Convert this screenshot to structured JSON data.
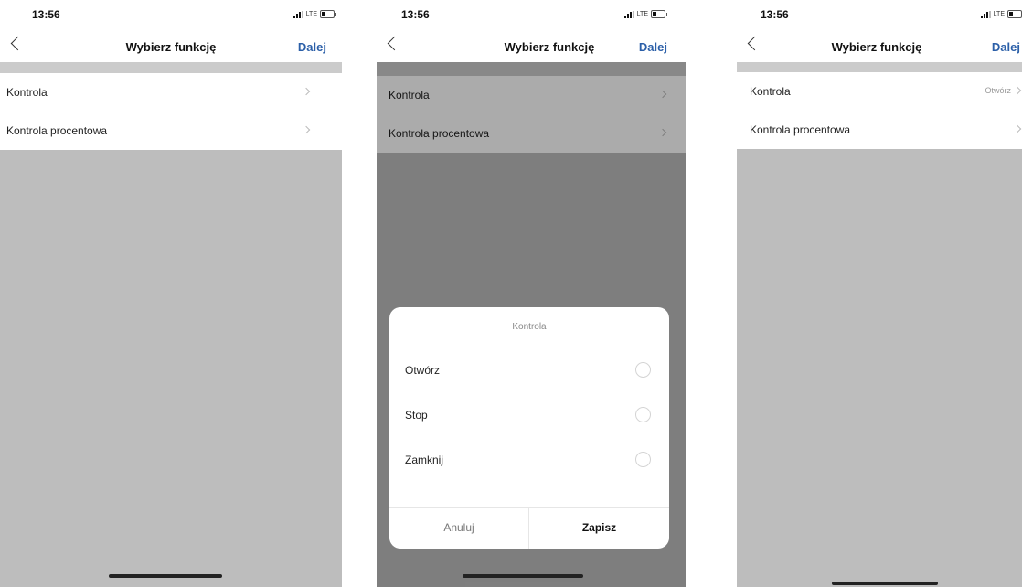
{
  "screens": [
    {
      "status": {
        "time": "13:56",
        "network": "LTE"
      },
      "nav": {
        "title": "Wybierz funkcję",
        "action": "Dalej"
      },
      "rows": [
        {
          "label": "Kontrola",
          "value": ""
        },
        {
          "label": "Kontrola procentowa",
          "value": ""
        }
      ]
    },
    {
      "status": {
        "time": "13:56",
        "network": "LTE"
      },
      "nav": {
        "title": "Wybierz funkcję",
        "action": "Dalej"
      },
      "rows": [
        {
          "label": "Kontrola",
          "value": ""
        },
        {
          "label": "Kontrola procentowa",
          "value": ""
        }
      ],
      "dialog": {
        "title": "Kontrola",
        "options": [
          {
            "label": "Otwórz",
            "selected": false
          },
          {
            "label": "Stop",
            "selected": false
          },
          {
            "label": "Zamknij",
            "selected": false
          }
        ],
        "cancel": "Anuluj",
        "save": "Zapisz"
      }
    },
    {
      "status": {
        "time": "13:56",
        "network": "LTE"
      },
      "nav": {
        "title": "Wybierz funkcję",
        "action": "Dalej"
      },
      "rows": [
        {
          "label": "Kontrola",
          "value": "Otwórz"
        },
        {
          "label": "Kontrola procentowa",
          "value": ""
        }
      ]
    }
  ],
  "icons": [
    "back-chevron-icon",
    "signal-icon",
    "battery-icon",
    "chevron-right-icon",
    "radio-icon"
  ],
  "colors": {
    "accent": "#2b5fa8",
    "background": "#bdbdbd",
    "strip": "#cbcbcb"
  }
}
